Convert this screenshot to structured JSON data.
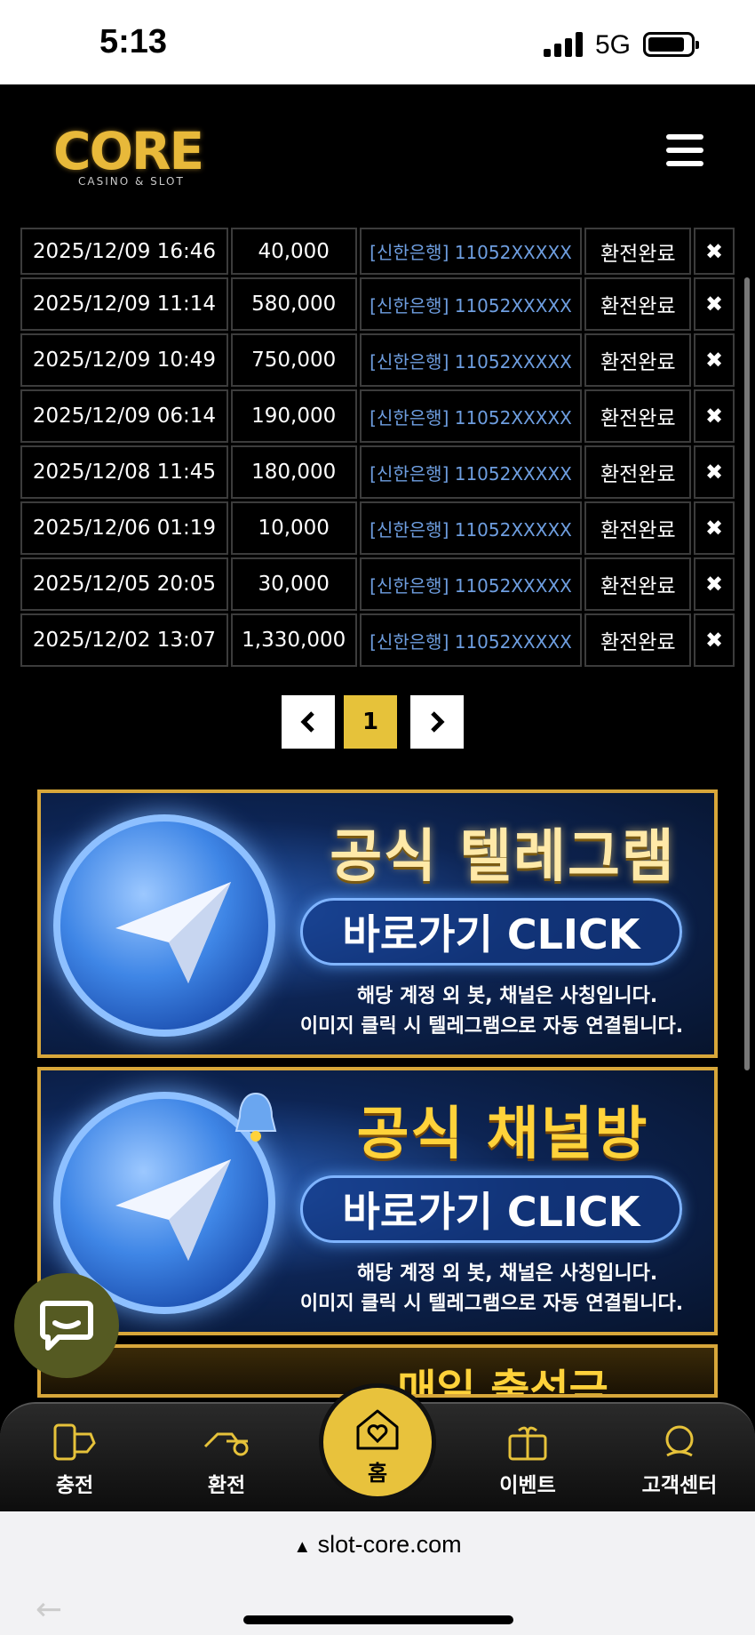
{
  "status_bar": {
    "time": "5:13",
    "network": "5G"
  },
  "header": {
    "logo_text": "CORE",
    "logo_sub": "CASINO & SLOT",
    "menu_icon": "hamburger-icon"
  },
  "table": {
    "rows": [
      {
        "date": "2025/12/09 16:46",
        "amount": "40,000",
        "account": "[신한은행] 11052XXXXX",
        "status": "환전완료",
        "action": "✖"
      },
      {
        "date": "2025/12/09 11:14",
        "amount": "580,000",
        "account": "[신한은행] 11052XXXXX",
        "status": "환전완료",
        "action": "✖"
      },
      {
        "date": "2025/12/09 10:49",
        "amount": "750,000",
        "account": "[신한은행] 11052XXXXX",
        "status": "환전완료",
        "action": "✖"
      },
      {
        "date": "2025/12/09 06:14",
        "amount": "190,000",
        "account": "[신한은행] 11052XXXXX",
        "status": "환전완료",
        "action": "✖"
      },
      {
        "date": "2025/12/08 11:45",
        "amount": "180,000",
        "account": "[신한은행] 11052XXXXX",
        "status": "환전완료",
        "action": "✖"
      },
      {
        "date": "2025/12/06 01:19",
        "amount": "10,000",
        "account": "[신한은행] 11052XXXXX",
        "status": "환전완료",
        "action": "✖"
      },
      {
        "date": "2025/12/05 20:05",
        "amount": "30,000",
        "account": "[신한은행] 11052XXXXX",
        "status": "환전완료",
        "action": "✖"
      },
      {
        "date": "2025/12/02 13:07",
        "amount": "1,330,000",
        "account": "[신한은행] 11052XXXXX",
        "status": "환전완료",
        "action": "✖"
      }
    ]
  },
  "pagination": {
    "prev": "‹",
    "current": "1",
    "next": "›"
  },
  "banners": [
    {
      "title": "공식 텔레그램",
      "cta": "바로가기 CLICK",
      "note1": "해당 계정 외 봇, 채널은 사칭입니다.",
      "note2": "이미지 클릭 시 텔레그램으로 자동 연결됩니다."
    },
    {
      "title": "공식 채널방",
      "cta": "바로가기 CLICK",
      "note1": "해당 계정 외 봇, 채널은 사칭입니다.",
      "note2": "이미지 클릭 시 텔레그램으로 자동 연결됩니다."
    },
    {
      "title": "매일 출석금"
    }
  ],
  "bottom_nav": {
    "deposit": "충전",
    "withdraw": "환전",
    "home": "홈",
    "event": "이벤트",
    "support": "고객센터"
  },
  "browser": {
    "url": "slot-core.com"
  },
  "colors": {
    "accent": "#e6c23a",
    "link": "#6e9ee0",
    "chat_fab": "#555a22"
  }
}
